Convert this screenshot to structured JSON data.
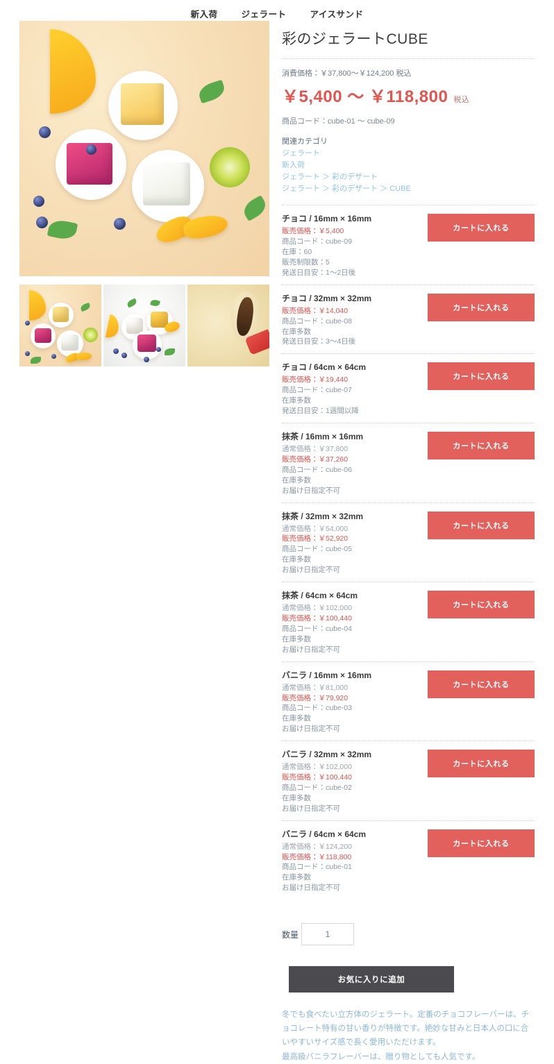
{
  "nav": {
    "items": [
      {
        "label": "新入荷"
      },
      {
        "label": "ジェラート"
      },
      {
        "label": "アイスサンド"
      }
    ]
  },
  "product": {
    "title": "彩のジェラートCUBE",
    "regular_price_line": "消費価格：￥37,800〜￥124,200 税込",
    "sale_price": "￥5,400 〜 ￥118,800",
    "sale_price_tax": "税込",
    "product_code": "商品コード：cube-01 〜 cube-09",
    "accent_color": "#e0554f",
    "cart_button_color": "#e3615c",
    "favorite_button_color": "#4a4a4f"
  },
  "categories": {
    "heading": "関連カテゴリ",
    "links": [
      "ジェラート",
      "新入荷",
      "ジェラート ＞ 彩のデザート",
      "ジェラート ＞ 彩のデザート ＞ CUBE"
    ]
  },
  "gallery": {
    "main_alt": "彩のジェラートCUBE メイン画像",
    "thumbnails": [
      {
        "alt": "ジェラートCUBE 盛り合わせ"
      },
      {
        "alt": "ジェラートCUBE 白背景"
      },
      {
        "alt": "バニラジェラート アップ"
      }
    ]
  },
  "variants": [
    {
      "name": "チョコ / 16mm × 16mm",
      "sale_price": "販売価格：￥5,400",
      "code": "商品コード：cube-09",
      "stock": "在庫：60",
      "limit": "販売制限数：5",
      "shipping": "発送日目安：1〜2日後",
      "cart_label": "カートに入れる"
    },
    {
      "name": "チョコ / 32mm × 32mm",
      "sale_price": "販売価格：￥14,040",
      "code": "商品コード：cube-08",
      "stock": "在庫多数",
      "shipping": "発送日目安：3〜4日後",
      "cart_label": "カートに入れる"
    },
    {
      "name": "チョコ / 64cm × 64cm",
      "sale_price": "販売価格：￥19,440",
      "code": "商品コード：cube-07",
      "stock": "在庫多数",
      "shipping": "発送日目安：1週間以降",
      "cart_label": "カートに入れる"
    },
    {
      "name": "抹茶 / 16mm × 16mm",
      "regular_price": "通常価格：￥37,800",
      "sale_price": "販売価格：￥37,260",
      "code": "商品コード：cube-06",
      "stock": "在庫多数",
      "shipping": "お届け日指定不可",
      "cart_label": "カートに入れる"
    },
    {
      "name": "抹茶 / 32mm × 32mm",
      "regular_price": "通常価格：￥54,000",
      "sale_price": "販売価格：￥52,920",
      "code": "商品コード：cube-05",
      "stock": "在庫多数",
      "shipping": "お届け日指定不可",
      "cart_label": "カートに入れる"
    },
    {
      "name": "抹茶 / 64cm × 64cm",
      "regular_price": "通常価格：￥102,000",
      "sale_price": "販売価格：￥100,440",
      "code": "商品コード：cube-04",
      "stock": "在庫多数",
      "shipping": "お届け日指定不可",
      "cart_label": "カートに入れる"
    },
    {
      "name": "バニラ / 16mm × 16mm",
      "regular_price": "通常価格：￥81,000",
      "sale_price": "販売価格：￥79,920",
      "code": "商品コード：cube-03",
      "stock": "在庫多数",
      "shipping": "お届け日指定不可",
      "cart_label": "カートに入れる"
    },
    {
      "name": "バニラ / 32mm × 32mm",
      "regular_price": "通常価格：￥102,000",
      "sale_price": "販売価格：￥100,440",
      "code": "商品コード：cube-02",
      "stock": "在庫多数",
      "shipping": "お届け日指定不可",
      "cart_label": "カートに入れる"
    },
    {
      "name": "バニラ / 64cm × 64cm",
      "regular_price": "通常価格：￥124,200",
      "sale_price": "販売価格：￥118,800",
      "code": "商品コード：cube-01",
      "stock": "在庫多数",
      "shipping": "お届け日指定不可",
      "cart_label": "カートに入れる"
    }
  ],
  "purchase": {
    "quantity_label": "数量",
    "quantity_value": "1",
    "favorite_label": "お気に入りに追加"
  },
  "description": {
    "paragraph1": "冬でも食べたい立方体のジェラート。定番のチョコフレーバーは、チョコレート特有の甘い香りが特徴です。絶妙な甘みと日本人の口に合いやすいサイズ感で長く愛用いただけます。",
    "paragraph2": "最高級バニラフレーバーは、贈り物としても人気です。"
  }
}
